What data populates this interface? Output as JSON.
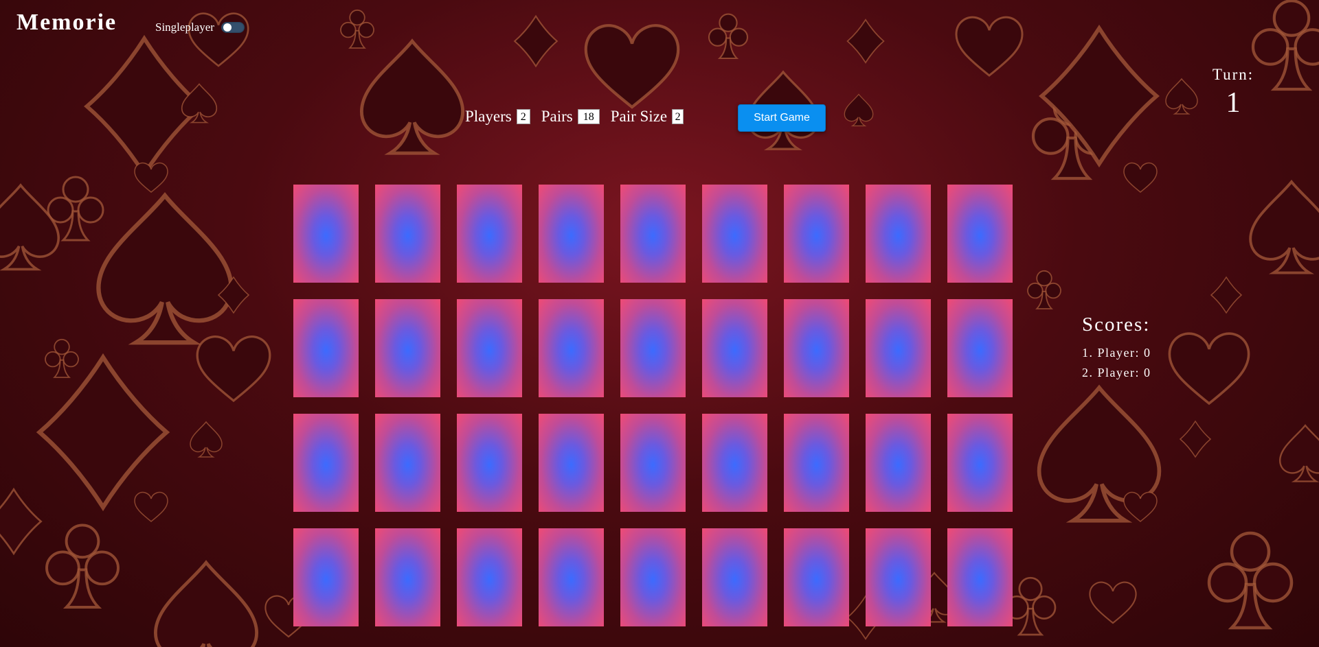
{
  "app": {
    "title": "Memorie"
  },
  "mode": {
    "label": "Singleplayer",
    "enabled": false
  },
  "settings": [
    {
      "key": "players",
      "label": "Players",
      "value": "2"
    },
    {
      "key": "pairs",
      "label": "Pairs",
      "value": "18"
    },
    {
      "key": "pair_size",
      "label": "Pair Size",
      "value": "2"
    }
  ],
  "start_button": {
    "label": "Start Game"
  },
  "turn": {
    "label": "Turn:",
    "value": "1"
  },
  "board": {
    "rows": 4,
    "columns": 9,
    "card_count": 36,
    "card_state": "face-down"
  },
  "scores": {
    "title": "Scores:",
    "entries": [
      "1. Player: 0",
      "2. Player: 0"
    ]
  },
  "colors": {
    "background": "#4a0a10",
    "card_center": "#3c6bff",
    "card_edge": "#f04b74",
    "button": "#0a8ff0",
    "suit_outline": "#a65a3a"
  }
}
